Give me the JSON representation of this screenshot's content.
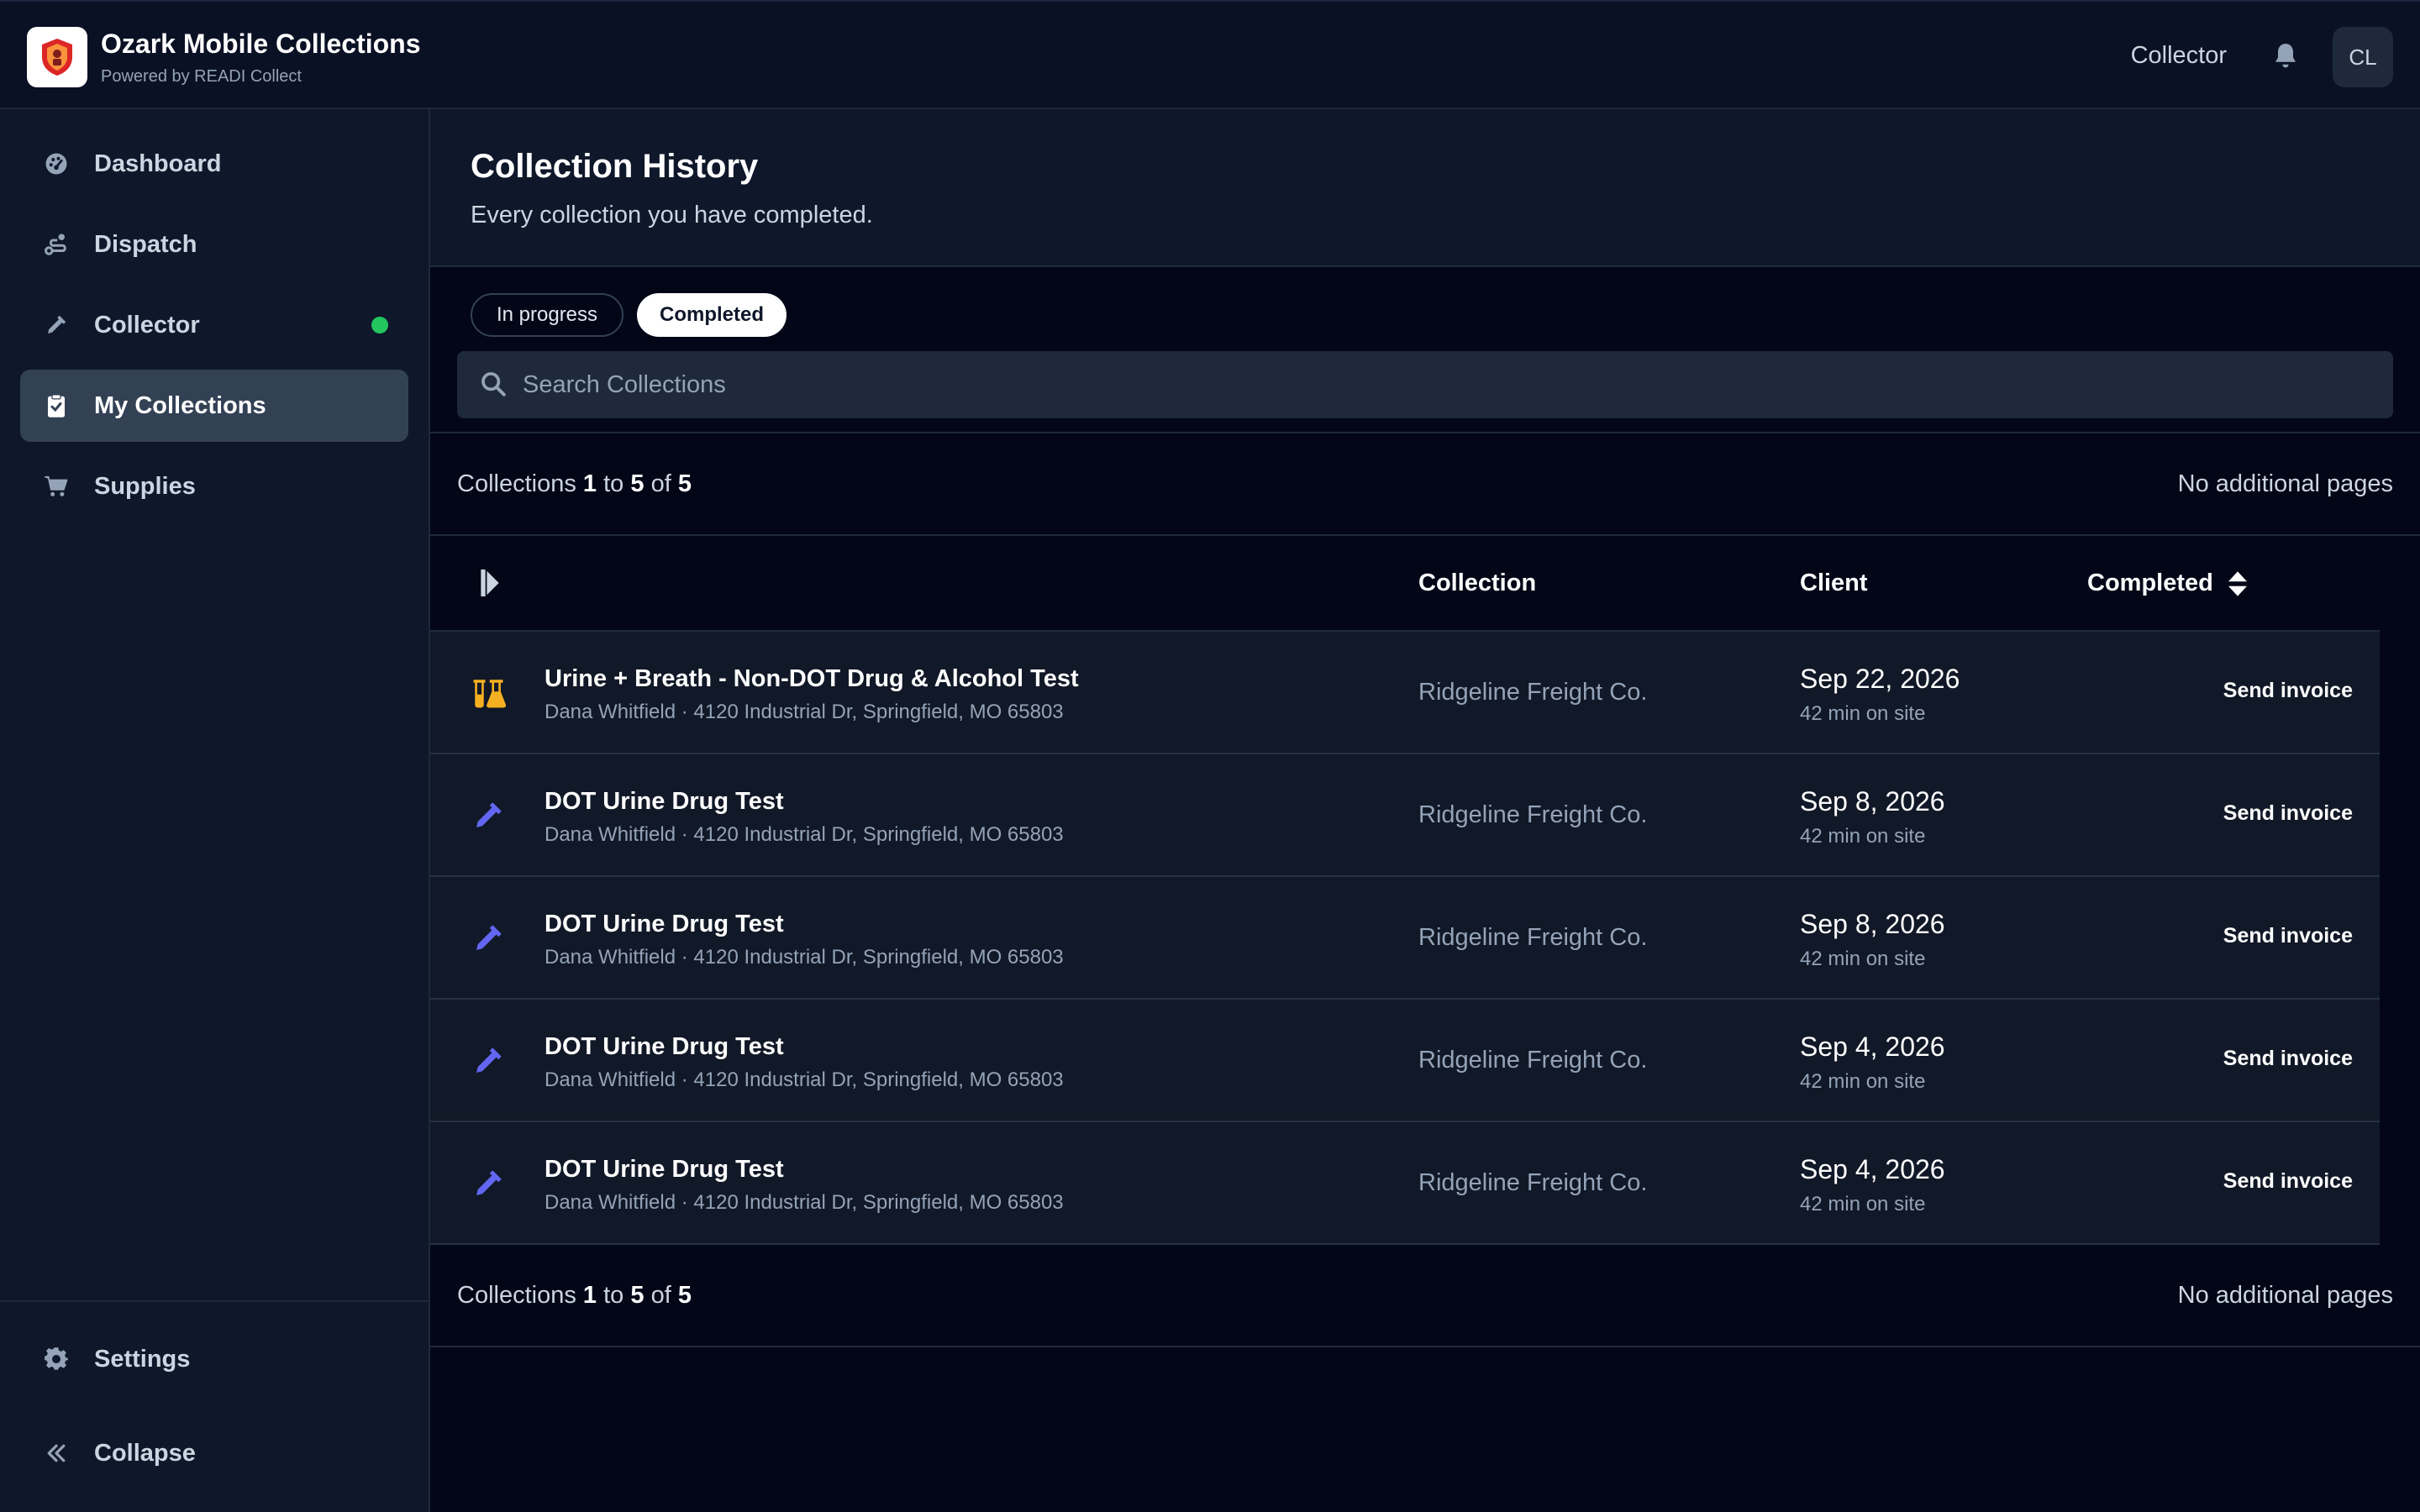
{
  "header": {
    "app_title": "Ozark Mobile Collections",
    "app_subtitle": "Powered by READI Collect",
    "role": "Collector",
    "avatar_initials": "CL"
  },
  "sidebar": {
    "items": [
      {
        "label": "Dashboard",
        "icon": "gauge-icon"
      },
      {
        "label": "Dispatch",
        "icon": "route-icon"
      },
      {
        "label": "Collector",
        "icon": "dropper-icon",
        "status": "online"
      },
      {
        "label": "My Collections",
        "icon": "clipboard-check-icon",
        "active": true
      },
      {
        "label": "Supplies",
        "icon": "cart-icon"
      }
    ],
    "settings_label": "Settings",
    "collapse_label": "Collapse"
  },
  "page": {
    "title": "Collection History",
    "subtitle": "Every collection you have completed."
  },
  "filters": {
    "in_progress": "In progress",
    "completed": "Completed",
    "selected": "Completed"
  },
  "search": {
    "placeholder": "Search Collections",
    "value": ""
  },
  "pagination": {
    "prefix": "Collections",
    "from": "1",
    "to_word": "to",
    "to": "5",
    "of_word": "of",
    "total": "5",
    "note": "No additional pages"
  },
  "table": {
    "columns": {
      "collection": "Collection",
      "client": "Client",
      "completed": "Completed"
    },
    "rows": [
      {
        "icon": "flask-icon",
        "title": "Urine + Breath - Non-DOT Drug & Alcohol Test",
        "detail": "Dana Whitfield · 4120 Industrial Dr, Springfield, MO 65803",
        "client": "Ridgeline Freight Co.",
        "date": "Sep 22, 2026",
        "duration": "42 min on site",
        "action": "Send invoice"
      },
      {
        "icon": "dropper-icon",
        "title": "DOT Urine Drug Test",
        "detail": "Dana Whitfield · 4120 Industrial Dr, Springfield, MO 65803",
        "client": "Ridgeline Freight Co.",
        "date": "Sep 8, 2026",
        "duration": "42 min on site",
        "action": "Send invoice"
      },
      {
        "icon": "dropper-icon",
        "title": "DOT Urine Drug Test",
        "detail": "Dana Whitfield · 4120 Industrial Dr, Springfield, MO 65803",
        "client": "Ridgeline Freight Co.",
        "date": "Sep 8, 2026",
        "duration": "42 min on site",
        "action": "Send invoice"
      },
      {
        "icon": "dropper-icon",
        "title": "DOT Urine Drug Test",
        "detail": "Dana Whitfield · 4120 Industrial Dr, Springfield, MO 65803",
        "client": "Ridgeline Freight Co.",
        "date": "Sep 4, 2026",
        "duration": "42 min on site",
        "action": "Send invoice"
      },
      {
        "icon": "dropper-icon",
        "title": "DOT Urine Drug Test",
        "detail": "Dana Whitfield · 4120 Industrial Dr, Springfield, MO 65803",
        "client": "Ridgeline Freight Co.",
        "date": "Sep 4, 2026",
        "duration": "42 min on site",
        "action": "Send invoice"
      }
    ]
  },
  "colors": {
    "background": "#020617",
    "sidebar": "#0f172a",
    "row": "#111827",
    "active_nav": "#334155",
    "status_online": "#22c55e",
    "flask_icon": "#f5b021",
    "dropper_icon": "#6366f1"
  }
}
